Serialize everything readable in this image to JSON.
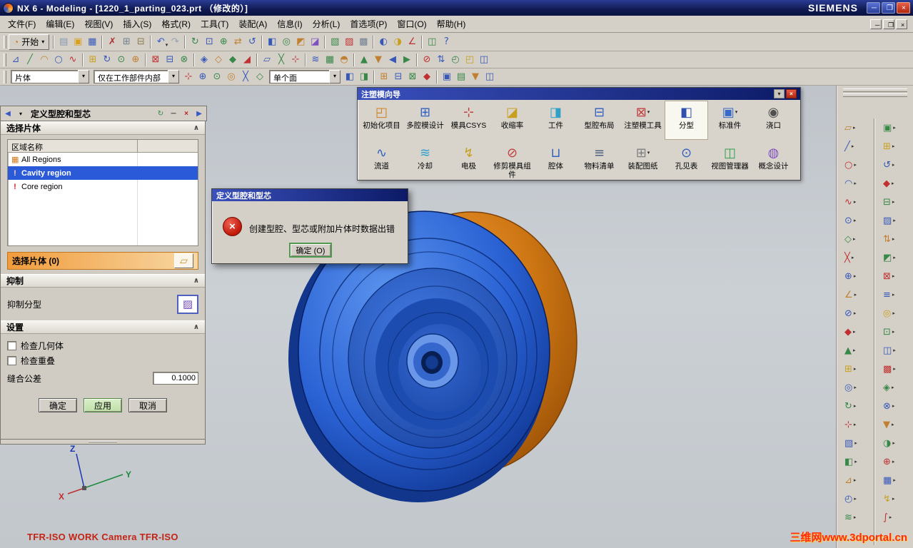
{
  "titlebar": {
    "title": "NX 6 - Modeling - [1220_1_parting_023.prt （修改的）]",
    "brand": "SIEMENS"
  },
  "icons": {
    "minimize": "─",
    "restore": "❐",
    "close": "×",
    "chevron_up": "∧",
    "dropdown": "▾",
    "back": "◀",
    "forward": "▶",
    "reload": "↻",
    "dash": "─",
    "cross": "×",
    "sheet": "▱",
    "suppress": "▨",
    "start": "◔"
  },
  "menubar": {
    "items": [
      "文件(F)",
      "编辑(E)",
      "视图(V)",
      "插入(S)",
      "格式(R)",
      "工具(T)",
      "装配(A)",
      "信息(I)",
      "分析(L)",
      "首选项(P)",
      "窗口(O)",
      "帮助(H)"
    ]
  },
  "toolbars": {
    "start_label": "开始",
    "row1": [
      {
        "n": "new",
        "g": "▤",
        "c": "#8898b0"
      },
      {
        "n": "open",
        "g": "▣",
        "c": "#d8a020"
      },
      {
        "n": "save",
        "g": "▦",
        "c": "#3858b8"
      },
      "|",
      {
        "n": "cut",
        "g": "✗",
        "c": "#b03030"
      },
      {
        "n": "copy",
        "g": "⊞",
        "c": "#708090"
      },
      {
        "n": "paste",
        "g": "⊟",
        "c": "#8a7a50"
      },
      "|",
      {
        "n": "undo",
        "g": "↶",
        "c": "#3858c8",
        "a": 1
      },
      {
        "n": "redo",
        "g": "↷",
        "c": "#98a0b0"
      },
      "|",
      {
        "n": "refresh",
        "g": "↻",
        "c": "#388848"
      },
      {
        "n": "fit-view",
        "g": "⊡",
        "c": "#3858b8"
      },
      {
        "n": "zoom",
        "g": "⊕",
        "c": "#388848"
      },
      {
        "n": "pan",
        "g": "⇄",
        "c": "#c08030"
      },
      {
        "n": "rotate",
        "g": "↺",
        "c": "#3858b8"
      },
      "|",
      {
        "n": "shaded",
        "g": "◧",
        "c": "#3858b8"
      },
      {
        "n": "wireframe",
        "g": "◎",
        "c": "#388848"
      },
      {
        "n": "orient",
        "g": "◩",
        "c": "#c08030"
      },
      {
        "n": "snapshot",
        "g": "◪",
        "c": "#8050c0"
      },
      "|",
      {
        "n": "layer",
        "g": "▧",
        "c": "#388848"
      },
      {
        "n": "display",
        "g": "▨",
        "c": "#c03030"
      },
      {
        "n": "scene",
        "g": "▩",
        "c": "#708090"
      },
      "|",
      {
        "n": "info",
        "g": "◐",
        "c": "#3858b8"
      },
      {
        "n": "analysis",
        "g": "◑",
        "c": "#c8a020"
      },
      {
        "n": "measure",
        "g": "∠",
        "c": "#c03030"
      },
      "|",
      {
        "n": "window",
        "g": "◫",
        "c": "#388848"
      },
      {
        "n": "help",
        "g": "?",
        "c": "#3858b8"
      }
    ],
    "row2": [
      {
        "n": "sketch",
        "g": "⊿",
        "c": "#3858b8"
      },
      {
        "n": "line",
        "g": "╱",
        "c": "#388848"
      },
      {
        "n": "arc",
        "g": "◠",
        "c": "#c08030"
      },
      {
        "n": "circle",
        "g": "○",
        "c": "#3858b8"
      },
      {
        "n": "spline",
        "g": "∿",
        "c": "#c03030"
      },
      "|",
      {
        "n": "extrude",
        "g": "⊞",
        "c": "#c8a020"
      },
      {
        "n": "revolve",
        "g": "↻",
        "c": "#3858b8"
      },
      {
        "n": "hole",
        "g": "⊙",
        "c": "#388848"
      },
      {
        "n": "boss",
        "g": "⊕",
        "c": "#c08030"
      },
      "|",
      {
        "n": "unite",
        "g": "⊠",
        "c": "#c03030"
      },
      {
        "n": "subtract",
        "g": "⊟",
        "c": "#3858b8"
      },
      {
        "n": "intersect",
        "g": "⊗",
        "c": "#388848"
      },
      "|",
      {
        "n": "blend",
        "g": "◈",
        "c": "#3858b8"
      },
      {
        "n": "chamfer",
        "g": "◇",
        "c": "#c08030"
      },
      {
        "n": "shell",
        "g": "◆",
        "c": "#388848"
      },
      {
        "n": "draft",
        "g": "◢",
        "c": "#c03030"
      },
      "|",
      {
        "n": "datum-plane",
        "g": "▱",
        "c": "#3858b8"
      },
      {
        "n": "datum-axis",
        "g": "╳",
        "c": "#388848"
      },
      {
        "n": "datum-csys",
        "g": "⊹",
        "c": "#c03030"
      },
      "|",
      {
        "n": "sweep",
        "g": "≋",
        "c": "#3858b8"
      },
      {
        "n": "mesh",
        "g": "▦",
        "c": "#388848"
      },
      {
        "n": "surface",
        "g": "◓",
        "c": "#c08030"
      },
      "|",
      {
        "n": "edit-up",
        "g": "▲",
        "c": "#388848"
      },
      {
        "n": "edit-down",
        "g": "▼",
        "c": "#c08030"
      },
      {
        "n": "edit-left",
        "g": "◀",
        "c": "#3858b8"
      },
      {
        "n": "edit-right",
        "g": "▶",
        "c": "#388848"
      },
      "|",
      {
        "n": "trim",
        "g": "⊘",
        "c": "#c03030"
      },
      {
        "n": "extend",
        "g": "⇅",
        "c": "#3858b8"
      },
      {
        "n": "offset",
        "g": "◴",
        "c": "#388848"
      },
      {
        "n": "pattern",
        "g": "◰",
        "c": "#c8a020"
      },
      {
        "n": "mirror",
        "g": "◫",
        "c": "#3858b8"
      }
    ],
    "row3a": [
      {
        "n": "snap-point",
        "g": "⊹",
        "c": "#c03030"
      },
      {
        "n": "snap-end",
        "g": "⊕",
        "c": "#3858b8"
      },
      {
        "n": "snap-mid",
        "g": "⊙",
        "c": "#388848"
      },
      {
        "n": "snap-center",
        "g": "◎",
        "c": "#c08030"
      },
      {
        "n": "snap-intersect",
        "g": "╳",
        "c": "#3858b8"
      },
      {
        "n": "snap-quadrant",
        "g": "◇",
        "c": "#388848"
      }
    ],
    "row3b": [
      {
        "n": "face-rule-a",
        "g": "◧",
        "c": "#3858b8"
      },
      {
        "n": "face-rule-b",
        "g": "◨",
        "c": "#388848"
      },
      "|",
      {
        "n": "select-a",
        "g": "⊞",
        "c": "#c08030"
      },
      {
        "n": "select-b",
        "g": "⊟",
        "c": "#3858b8"
      },
      {
        "n": "select-c",
        "g": "⊠",
        "c": "#388848"
      },
      {
        "n": "select-d",
        "g": "◆",
        "c": "#c03030"
      },
      "|",
      {
        "n": "select-e",
        "g": "▣",
        "c": "#3858b8"
      },
      {
        "n": "select-f",
        "g": "▤",
        "c": "#388848"
      },
      {
        "n": "select-g",
        "g": "▼",
        "c": "#c08030"
      },
      {
        "n": "select-h",
        "g": "◫",
        "c": "#3858b8"
      }
    ]
  },
  "selection_bar": {
    "type_filter": "片体",
    "scope_filter": "仅在工作部件内部",
    "face_filter": "单个面"
  },
  "mold_wizard": {
    "title": "注塑模向导",
    "row1": [
      {
        "label": "初始化项目",
        "g": "◰",
        "c": "#d08020"
      },
      {
        "label": "多腔模设计",
        "g": "⊞",
        "c": "#3060c0"
      },
      {
        "label": "模具CSYS",
        "g": "⊹",
        "c": "#c04040"
      },
      {
        "label": "收缩率",
        "g": "◪",
        "c": "#c8a020"
      },
      {
        "label": "工件",
        "g": "◨",
        "c": "#30a0c8"
      },
      {
        "label": "型腔布局",
        "g": "⊟",
        "c": "#3060c0"
      },
      {
        "label": "注塑模工具",
        "g": "⊠",
        "c": "#c04040",
        "a": 1
      },
      {
        "label": "分型",
        "g": "◧",
        "c": "#3050b0",
        "sel": 1
      },
      {
        "label": "标准件",
        "g": "▣",
        "c": "#3868c8",
        "a": 1
      },
      {
        "label": "浇口",
        "g": "◉",
        "c": "#505050"
      }
    ],
    "row2": [
      {
        "label": "流道",
        "g": "∿",
        "c": "#3060c0"
      },
      {
        "label": "冷却",
        "g": "≋",
        "c": "#30a0d0"
      },
      {
        "label": "电极",
        "g": "↯",
        "c": "#c8a020"
      },
      {
        "label": "修剪模具组件",
        "g": "⊘",
        "c": "#c04040"
      },
      {
        "label": "腔体",
        "g": "⊔",
        "c": "#3060c0"
      },
      {
        "label": "物料清单",
        "g": "≡",
        "c": "#506080"
      },
      {
        "label": "装配图纸",
        "g": "⊞",
        "c": "#808080",
        "a": 1
      },
      {
        "label": "孔见表",
        "g": "⊙",
        "c": "#3060c0"
      },
      {
        "label": "视图管理器",
        "g": "◫",
        "c": "#30a050"
      },
      {
        "label": "概念设计",
        "g": "◍",
        "c": "#8050c0"
      }
    ]
  },
  "left_panel": {
    "title": "定义型腔和型芯",
    "select_sheet_section": "选择片体",
    "region_header": "区域名称",
    "regions": [
      {
        "label": "All Regions",
        "icon": "regions",
        "selected": false
      },
      {
        "label": "Cavity region",
        "icon": "warning",
        "selected": true
      },
      {
        "label": "Core region",
        "icon": "warning",
        "selected": false
      }
    ],
    "select_sheet_label": "选择片体 (0)",
    "suppress_section": "抑制",
    "suppress_parting_label": "抑制分型",
    "settings_section": "设置",
    "check_geometry_label": "检查几何体",
    "check_overlap_label": "检查重叠",
    "sew_tolerance_label": "缝合公差",
    "sew_tolerance_value": "0.1000",
    "ok_label": "确定",
    "apply_label": "应用",
    "cancel_label": "取消"
  },
  "error_dialog": {
    "title": "定义型腔和型芯",
    "message": "创建型腔、型芯或附加片体时数据出错",
    "ok_label": "确定 (O)"
  },
  "right_rails": {
    "col1": [
      {
        "g": "▱",
        "c": "#c08030"
      },
      {
        "g": "╱",
        "c": "#3858b8"
      },
      {
        "g": "○",
        "c": "#c03030"
      },
      {
        "g": "◠",
        "c": "#3858b8"
      },
      {
        "g": "∿",
        "c": "#c03030"
      },
      {
        "g": "⊙",
        "c": "#3858b8"
      },
      {
        "g": "◇",
        "c": "#388848"
      },
      {
        "g": "╳",
        "c": "#c03030"
      },
      {
        "g": "⊕",
        "c": "#3858b8"
      },
      {
        "g": "∠",
        "c": "#c08030"
      },
      {
        "g": "⊘",
        "c": "#3858b8"
      },
      {
        "g": "◆",
        "c": "#c03030"
      },
      {
        "g": "▲",
        "c": "#388848"
      },
      {
        "g": "⊞",
        "c": "#c8a020"
      },
      {
        "g": "◎",
        "c": "#3858b8"
      },
      {
        "g": "↻",
        "c": "#388848"
      },
      {
        "g": "⊹",
        "c": "#c03030"
      },
      {
        "g": "▧",
        "c": "#3858b8"
      },
      {
        "g": "◧",
        "c": "#388848"
      },
      {
        "g": "⊿",
        "c": "#c08030"
      },
      {
        "g": "◴",
        "c": "#3858b8"
      },
      {
        "g": "≋",
        "c": "#388848"
      }
    ],
    "col2": [
      {
        "g": "▣",
        "c": "#388848"
      },
      {
        "g": "⊞",
        "c": "#c8a020"
      },
      {
        "g": "↺",
        "c": "#3858b8"
      },
      {
        "g": "◆",
        "c": "#c03030"
      },
      {
        "g": "⊟",
        "c": "#388848"
      },
      {
        "g": "▨",
        "c": "#3858b8"
      },
      {
        "g": "⇅",
        "c": "#c08030"
      },
      {
        "g": "◩",
        "c": "#388848"
      },
      {
        "g": "⊠",
        "c": "#c03030"
      },
      {
        "g": "≡",
        "c": "#3858b8"
      },
      {
        "g": "◎",
        "c": "#c8a020"
      },
      {
        "g": "⊡",
        "c": "#388848"
      },
      {
        "g": "◫",
        "c": "#3858b8"
      },
      {
        "g": "▩",
        "c": "#c03030"
      },
      {
        "g": "◈",
        "c": "#388848"
      },
      {
        "g": "⊗",
        "c": "#3858b8"
      },
      {
        "g": "▼",
        "c": "#c08030"
      },
      {
        "g": "◑",
        "c": "#388848"
      },
      {
        "g": "⊕",
        "c": "#c03030"
      },
      {
        "g": "▦",
        "c": "#3858b8"
      },
      {
        "g": "↯",
        "c": "#c8a020"
      },
      {
        "g": "∫",
        "c": "#c03030"
      }
    ]
  },
  "viewport": {
    "status_text": "TFR-ISO WORK Camera TFR-ISO",
    "watermark": "三维网www.3dportal.cn",
    "triad": {
      "x": "X",
      "y": "Y",
      "z": "Z"
    }
  }
}
